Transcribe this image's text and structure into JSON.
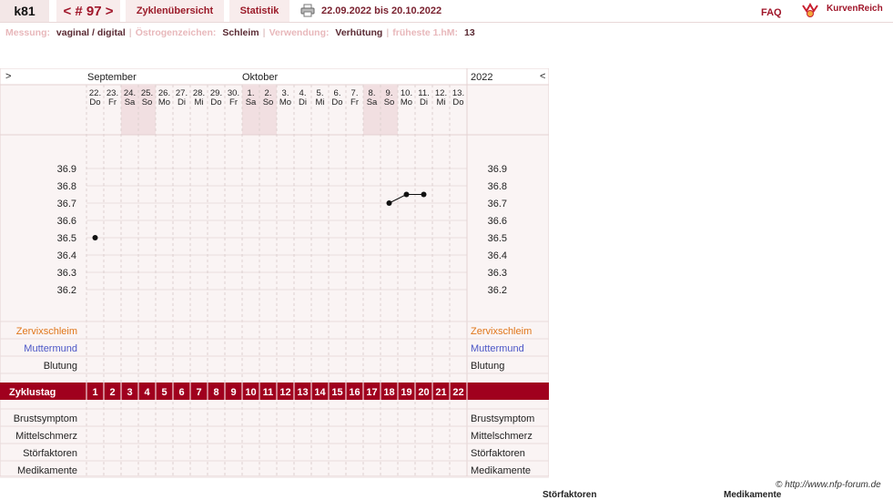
{
  "top": {
    "user": "k81",
    "cycle_nav": "< # 97 >",
    "cycle_overview": "Zyklenübersicht",
    "statistics": "Statistik",
    "date_range": "22.09.2022 bis 20.10.2022",
    "faq": "FAQ",
    "logo_text": "KurvenReich"
  },
  "meta": [
    {
      "label": "Messung:",
      "value": "vaginal / digital"
    },
    {
      "label": "Östrogenzeichen:",
      "value": "Schleim"
    },
    {
      "label": "Verwendung:",
      "value": "Verhütung"
    },
    {
      "label": "früheste 1.hM:",
      "value": "13"
    }
  ],
  "chart_header": {
    "nav_prev": ">",
    "nav_next": "<",
    "month1": "September",
    "month2": "Oktober",
    "year": "2022"
  },
  "days": [
    {
      "date": "22.",
      "weekday": "Do",
      "weekend": false
    },
    {
      "date": "23.",
      "weekday": "Fr",
      "weekend": false
    },
    {
      "date": "24.",
      "weekday": "Sa",
      "weekend": true
    },
    {
      "date": "25.",
      "weekday": "So",
      "weekend": true
    },
    {
      "date": "26.",
      "weekday": "Mo",
      "weekend": false
    },
    {
      "date": "27.",
      "weekday": "Di",
      "weekend": false
    },
    {
      "date": "28.",
      "weekday": "Mi",
      "weekend": false
    },
    {
      "date": "29.",
      "weekday": "Do",
      "weekend": false
    },
    {
      "date": "30.",
      "weekday": "Fr",
      "weekend": false
    },
    {
      "date": "1.",
      "weekday": "Sa",
      "weekend": true
    },
    {
      "date": "2.",
      "weekday": "So",
      "weekend": true
    },
    {
      "date": "3.",
      "weekday": "Mo",
      "weekend": false
    },
    {
      "date": "4.",
      "weekday": "Di",
      "weekend": false
    },
    {
      "date": "5.",
      "weekday": "Mi",
      "weekend": false
    },
    {
      "date": "6.",
      "weekday": "Do",
      "weekend": false
    },
    {
      "date": "7.",
      "weekday": "Fr",
      "weekend": false
    },
    {
      "date": "8.",
      "weekday": "Sa",
      "weekend": true
    },
    {
      "date": "9.",
      "weekday": "So",
      "weekend": true
    },
    {
      "date": "10.",
      "weekday": "Mo",
      "weekend": false
    },
    {
      "date": "11.",
      "weekday": "Di",
      "weekend": false
    },
    {
      "date": "12.",
      "weekday": "Mi",
      "weekend": false
    },
    {
      "date": "13.",
      "weekday": "Do",
      "weekend": false
    }
  ],
  "temp_ticks": [
    "36.9",
    "36.8",
    "36.7",
    "36.6",
    "36.5",
    "36.4",
    "36.3",
    "36.2"
  ],
  "temperatures": [
    {
      "cycle_day": 1,
      "temp": 36.5
    },
    {
      "cycle_day": 18,
      "temp": 36.7
    },
    {
      "cycle_day": 19,
      "temp": 36.75
    },
    {
      "cycle_day": 20,
      "temp": 36.75
    }
  ],
  "rows_upper": [
    {
      "label": "Zervixschleim",
      "color": "#e0761a"
    },
    {
      "label": "Muttermund",
      "color": "#4b56c6"
    },
    {
      "label": "Blutung",
      "color": "#222222"
    }
  ],
  "zyklustag_label": "Zyklustag",
  "cycle_days": [
    "1",
    "2",
    "3",
    "4",
    "5",
    "6",
    "7",
    "8",
    "9",
    "10",
    "11",
    "12",
    "13",
    "14",
    "15",
    "16",
    "17",
    "18",
    "19",
    "20",
    "21",
    "22"
  ],
  "rows_lower": [
    "Brustsymptom",
    "Mittelschmerz",
    "Störfaktoren",
    "Medikamente"
  ],
  "footer": {
    "copyright": "© http://www.nfp-forum.de",
    "cut1": "Störfaktoren",
    "cut2": "Medikamente"
  },
  "colors": {
    "accent": "#a0162a",
    "bar": "#a0001e",
    "panel_bg": "#faf4f4",
    "weekend_bg": "#f1dfe1"
  }
}
